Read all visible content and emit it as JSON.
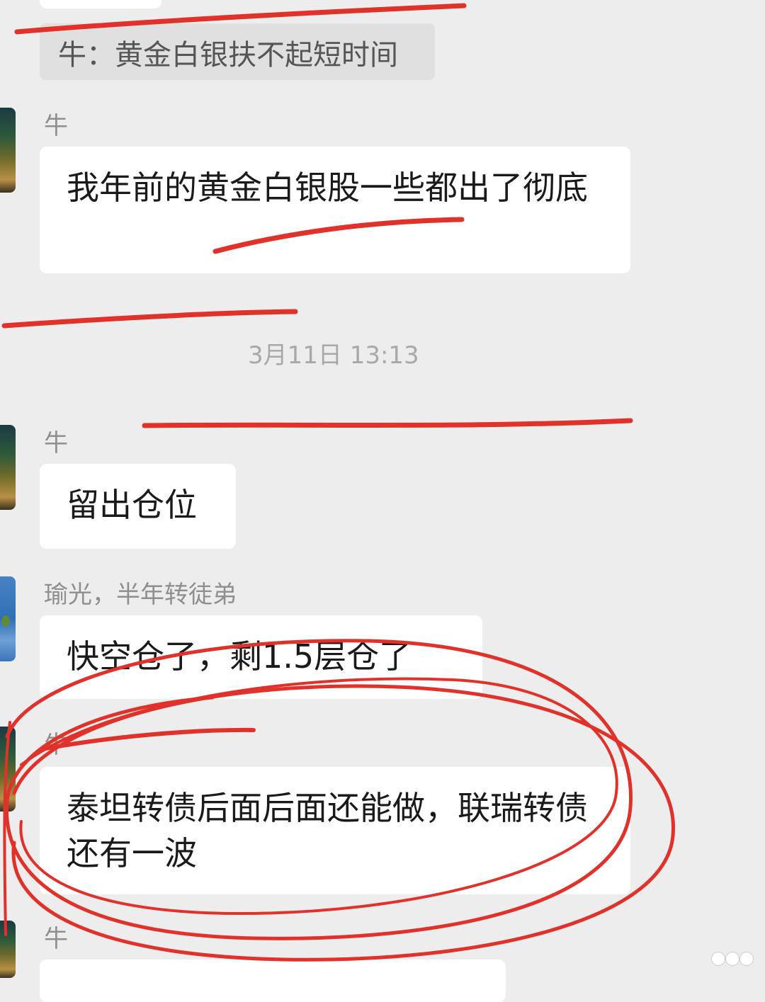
{
  "quote_message": {
    "text": "牛：黄金白银扶不起短时间"
  },
  "messages": [
    {
      "sender": "牛",
      "text": "我年前的黄金白银股一些都出了彻底"
    },
    {
      "sender": "牛",
      "text": "留出仓位"
    },
    {
      "sender": "瑜光，半年转徒弟",
      "text": "快空仓了，剩1.5层仓了"
    },
    {
      "sender": "牛",
      "text": "泰坦转债后面后面还能做，联瑞转债还有一波"
    },
    {
      "sender": "牛",
      "text": ""
    }
  ],
  "timestamp": "3月11日 13:13",
  "annotation_color": "#e0322b"
}
